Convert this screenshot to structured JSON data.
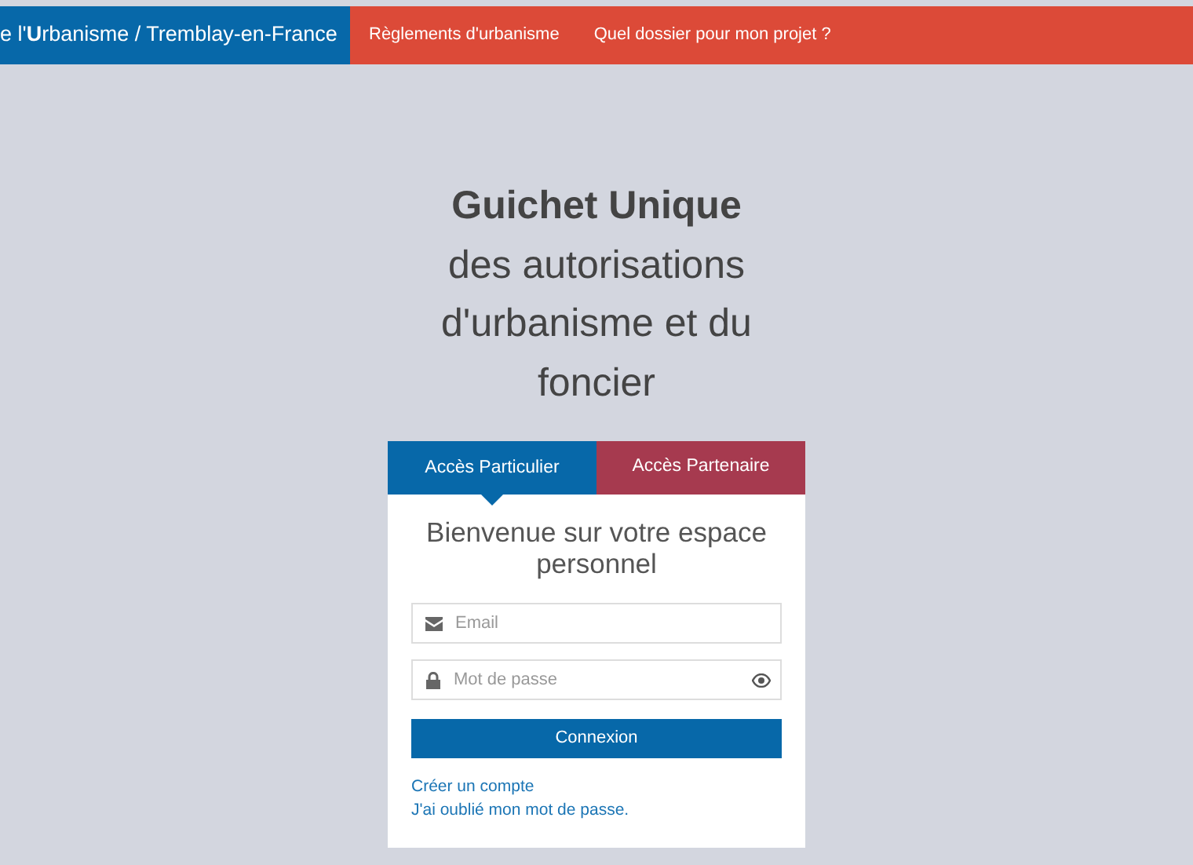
{
  "navbar": {
    "brand": "e l'**U**rbanisme / Tremblay-en-France",
    "links": [
      "Règlements d'urbanisme",
      "Quel dossier pour mon projet ?"
    ]
  },
  "heading": {
    "title": "Guichet Unique",
    "subtitle": "des autorisations d'urbanisme et du foncier"
  },
  "login": {
    "tabs": [
      {
        "label": "Accès Particulier",
        "selected": true
      },
      {
        "label": "Accès Partenaire",
        "selected": false
      }
    ],
    "welcome": "Bienvenue sur votre espace personnel",
    "email": {
      "placeholder": "Email"
    },
    "password": {
      "placeholder": "Mot de passe"
    },
    "submit": "Connexion",
    "links": [
      "Créer un compte",
      "J'ai oublié mon mot de passe."
    ]
  }
}
